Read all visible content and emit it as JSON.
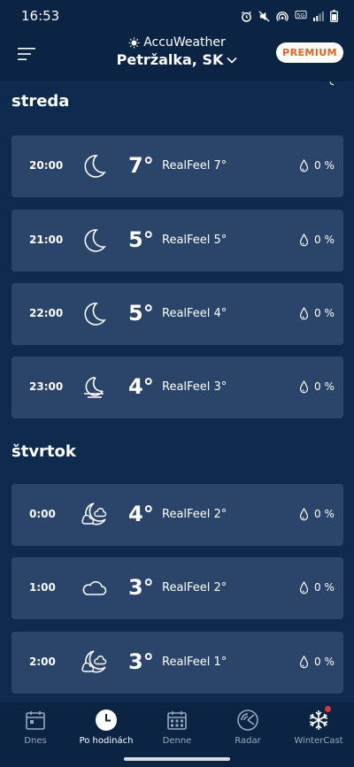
{
  "status_bar": {
    "time": "16:53"
  },
  "header": {
    "brand": "AccuWeather",
    "location": "Petržalka, SK",
    "premium_label": "PREMIUM"
  },
  "days": [
    {
      "name": "streda",
      "hours": [
        {
          "time": "20:00",
          "icon": "moon-icon",
          "temp": "7°",
          "realfeel": "RealFeel 7°",
          "precip": "0 %"
        },
        {
          "time": "21:00",
          "icon": "moon-icon",
          "temp": "5°",
          "realfeel": "RealFeel 5°",
          "precip": "0 %"
        },
        {
          "time": "22:00",
          "icon": "moon-icon",
          "temp": "5°",
          "realfeel": "RealFeel 4°",
          "precip": "0 %"
        },
        {
          "time": "23:00",
          "icon": "moon-haze-icon",
          "temp": "4°",
          "realfeel": "RealFeel 3°",
          "precip": "0 %"
        }
      ]
    },
    {
      "name": "štvrtok",
      "hours": [
        {
          "time": "0:00",
          "icon": "moon-cloud-icon",
          "temp": "4°",
          "realfeel": "RealFeel 2°",
          "precip": "0 %"
        },
        {
          "time": "1:00",
          "icon": "cloud-icon",
          "temp": "3°",
          "realfeel": "RealFeel 2°",
          "precip": "0 %"
        },
        {
          "time": "2:00",
          "icon": "moon-cloud-icon",
          "temp": "3°",
          "realfeel": "RealFeel 1°",
          "precip": "0 %"
        }
      ]
    }
  ],
  "bottom_nav": [
    {
      "label": "Dnes",
      "icon": "calendar-icon",
      "active": false
    },
    {
      "label": "Po hodinách",
      "icon": "clock-icon",
      "active": true
    },
    {
      "label": "Denne",
      "icon": "calendar-grid-icon",
      "active": false
    },
    {
      "label": "Radar",
      "icon": "radar-icon",
      "active": false
    },
    {
      "label": "WinterCast",
      "icon": "snowflake-icon",
      "active": false
    }
  ],
  "colors": {
    "background": "#0f2a4f",
    "header": "#0c2444",
    "card": "#2a4569",
    "premium_text": "#e2631e",
    "badge": "#d9353b"
  }
}
